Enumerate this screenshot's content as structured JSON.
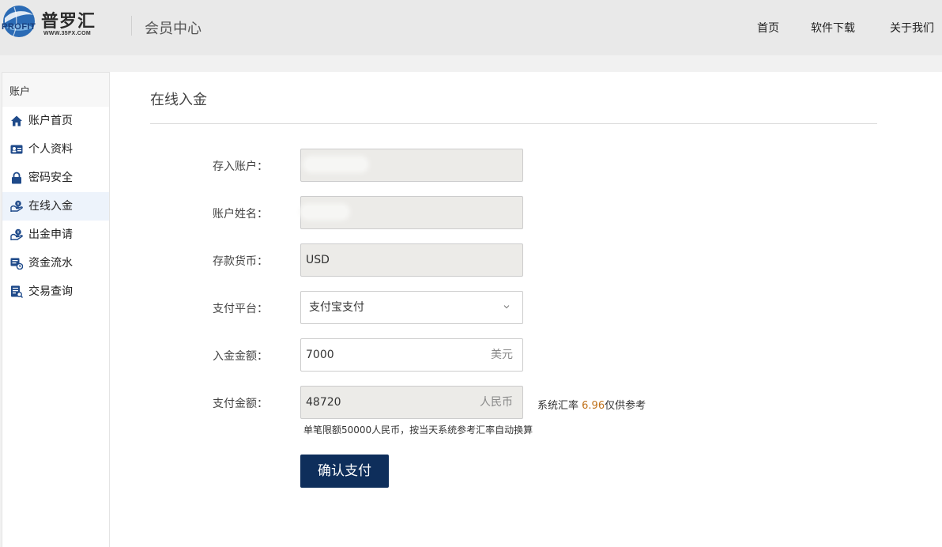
{
  "header": {
    "logo_cn": "普罗汇",
    "logo_en": "PROFIT",
    "logo_url": "WWW.35FX.COM",
    "title": "会员中心",
    "nav": {
      "home": "首页",
      "download": "软件下载",
      "about": "关于我们"
    }
  },
  "sidebar": {
    "heading": "账户",
    "items": [
      {
        "label": "账户首页",
        "icon": "home-icon",
        "active": false
      },
      {
        "label": "个人资料",
        "icon": "id-card-icon",
        "active": false
      },
      {
        "label": "密码安全",
        "icon": "lock-icon",
        "active": false
      },
      {
        "label": "在线入金",
        "icon": "deposit-icon",
        "active": true
      },
      {
        "label": "出金申请",
        "icon": "withdraw-icon",
        "active": false
      },
      {
        "label": "资金流水",
        "icon": "funds-flow-icon",
        "active": false
      },
      {
        "label": "交易查询",
        "icon": "trade-query-icon",
        "active": false
      }
    ]
  },
  "main": {
    "title": "在线入金",
    "form": {
      "account": {
        "label": "存入账户：",
        "value": ""
      },
      "name": {
        "label": "账户姓名：",
        "value": ""
      },
      "currency": {
        "label": "存款货币：",
        "value": "USD"
      },
      "platform": {
        "label": "支付平台：",
        "value": "支付宝支付"
      },
      "amount": {
        "label": "入金金额：",
        "value": "7000",
        "suffix": "美元"
      },
      "pay_amount": {
        "label": "支付金额：",
        "value": "48720",
        "suffix": "人民币"
      }
    },
    "rate": {
      "prefix": "系统汇率",
      "value": "6.96",
      "suffix": "仅供参考"
    },
    "hint": "单笔限额50000人民币，按当天系统参考汇率自动换算",
    "submit_label": "确认支付"
  },
  "colors": {
    "accent": "#0e2e5b",
    "rate": "#c0721b",
    "icon": "#1f4a8a"
  }
}
